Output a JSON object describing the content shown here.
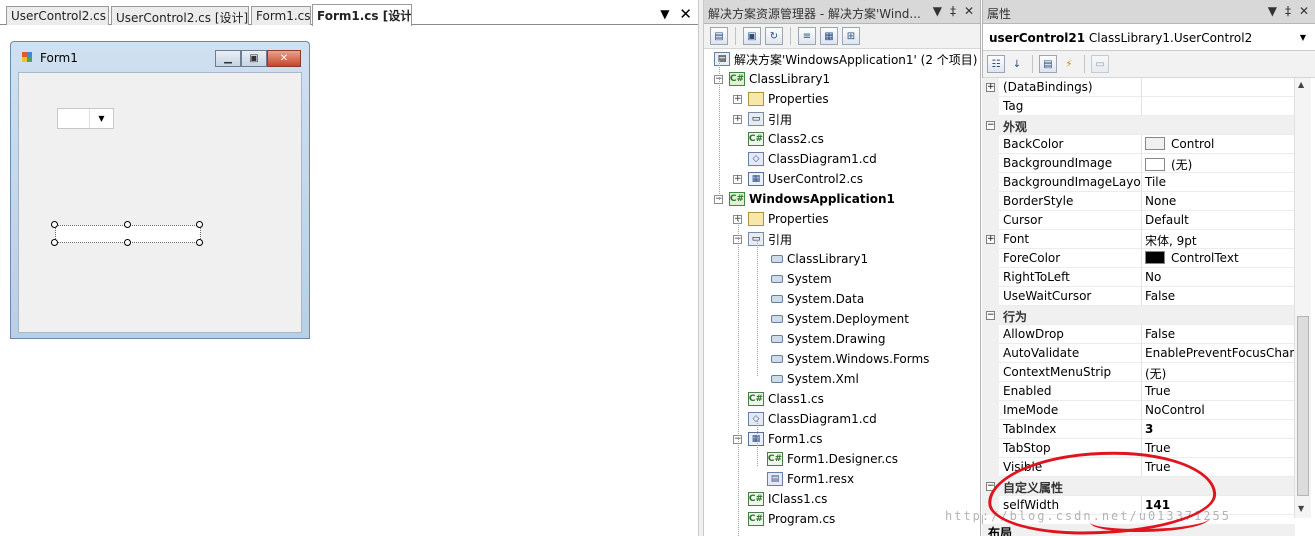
{
  "designer": {
    "tabs": [
      {
        "label": "UserControl2.cs"
      },
      {
        "label": "UserControl2.cs [设计]"
      },
      {
        "label": "Form1.cs"
      },
      {
        "label": "Form1.cs [设计]",
        "active": true
      }
    ],
    "tab_controls": {
      "dropdown": "▼",
      "close": "✕"
    },
    "form": {
      "title": "Form1",
      "min": "▁",
      "max": "▣",
      "close": "✕",
      "combo_arrow": "▼"
    }
  },
  "solution_explorer": {
    "title": "解决方案资源管理器 - 解决方案'Wind...",
    "title_controls": {
      "dropdown": "▼",
      "pin": "‡",
      "close": "✕"
    },
    "toolbar_icons": [
      "properties-icon",
      "show-all-files-icon",
      "refresh-icon",
      "view-code-icon",
      "view-designer-icon",
      "class-diagram-icon"
    ],
    "items": [
      {
        "label": "解决方案'WindowsApplication1' (2 个项目)",
        "icon": "solution",
        "level": 0,
        "expander": ""
      },
      {
        "label": "ClassLibrary1",
        "icon": "project",
        "level": 1,
        "expander": "−"
      },
      {
        "label": "Properties",
        "icon": "folder",
        "level": 2,
        "expander": "+"
      },
      {
        "label": "引用",
        "icon": "references",
        "level": 2,
        "expander": "+"
      },
      {
        "label": "Class2.cs",
        "icon": "cs",
        "level": 2,
        "expander": ""
      },
      {
        "label": "ClassDiagram1.cd",
        "icon": "cd",
        "level": 2,
        "expander": ""
      },
      {
        "label": "UserControl2.cs",
        "icon": "form",
        "level": 2,
        "expander": "+"
      },
      {
        "label": "WindowsApplication1",
        "icon": "project",
        "level": 1,
        "expander": "−",
        "bold": true
      },
      {
        "label": "Properties",
        "icon": "folder",
        "level": 2,
        "expander": "+"
      },
      {
        "label": "引用",
        "icon": "references",
        "level": 2,
        "expander": "−"
      },
      {
        "label": "ClassLibrary1",
        "icon": "assembly",
        "level": 3,
        "expander": ""
      },
      {
        "label": "System",
        "icon": "assembly",
        "level": 3,
        "expander": ""
      },
      {
        "label": "System.Data",
        "icon": "assembly",
        "level": 3,
        "expander": ""
      },
      {
        "label": "System.Deployment",
        "icon": "assembly",
        "level": 3,
        "expander": ""
      },
      {
        "label": "System.Drawing",
        "icon": "assembly",
        "level": 3,
        "expander": ""
      },
      {
        "label": "System.Windows.Forms",
        "icon": "assembly",
        "level": 3,
        "expander": ""
      },
      {
        "label": "System.Xml",
        "icon": "assembly",
        "level": 3,
        "expander": ""
      },
      {
        "label": "Class1.cs",
        "icon": "cs",
        "level": 2,
        "expander": ""
      },
      {
        "label": "ClassDiagram1.cd",
        "icon": "cd",
        "level": 2,
        "expander": ""
      },
      {
        "label": "Form1.cs",
        "icon": "form",
        "level": 2,
        "expander": "−"
      },
      {
        "label": "Form1.Designer.cs",
        "icon": "cs",
        "level": 3,
        "expander": ""
      },
      {
        "label": "Form1.resx",
        "icon": "resx",
        "level": 3,
        "expander": ""
      },
      {
        "label": "IClass1.cs",
        "icon": "cs",
        "level": 2,
        "expander": ""
      },
      {
        "label": "Program.cs",
        "icon": "cs",
        "level": 2,
        "expander": ""
      }
    ]
  },
  "properties": {
    "title": "属性",
    "title_controls": {
      "dropdown": "▼",
      "pin": "‡",
      "close": "✕"
    },
    "object_name": "userControl21",
    "object_type": "ClassLibrary1.UserControl2",
    "object_arrow": "▼",
    "toolbar_icons": [
      "categorized-icon",
      "alphabetical-icon",
      "properties-icon",
      "events-icon",
      "property-pages-icon"
    ],
    "rows": [
      {
        "type": "prop",
        "name": "(DataBindings)",
        "value": "",
        "expander": "+"
      },
      {
        "type": "prop",
        "name": "Tag",
        "value": ""
      },
      {
        "type": "cat",
        "name": "外观",
        "expander": "−"
      },
      {
        "type": "prop",
        "name": "BackColor",
        "value": "Control",
        "swatch": "#f0f0f0"
      },
      {
        "type": "prop",
        "name": "BackgroundImage",
        "value": "(无)",
        "swatch": "#ffffff"
      },
      {
        "type": "prop",
        "name": "BackgroundImageLayo",
        "value": "Tile"
      },
      {
        "type": "prop",
        "name": "BorderStyle",
        "value": "None"
      },
      {
        "type": "prop",
        "name": "Cursor",
        "value": "Default"
      },
      {
        "type": "prop",
        "name": "Font",
        "value": "宋体, 9pt",
        "expander": "+"
      },
      {
        "type": "prop",
        "name": "ForeColor",
        "value": "ControlText",
        "swatch": "#000000"
      },
      {
        "type": "prop",
        "name": "RightToLeft",
        "value": "No"
      },
      {
        "type": "prop",
        "name": "UseWaitCursor",
        "value": "False"
      },
      {
        "type": "cat",
        "name": "行为",
        "expander": "−"
      },
      {
        "type": "prop",
        "name": "AllowDrop",
        "value": "False"
      },
      {
        "type": "prop",
        "name": "AutoValidate",
        "value": "EnablePreventFocusChang"
      },
      {
        "type": "prop",
        "name": "ContextMenuStrip",
        "value": "(无)"
      },
      {
        "type": "prop",
        "name": "Enabled",
        "value": "True"
      },
      {
        "type": "prop",
        "name": "ImeMode",
        "value": "NoControl"
      },
      {
        "type": "prop",
        "name": "TabIndex",
        "value": "3",
        "bold": true
      },
      {
        "type": "prop",
        "name": "TabStop",
        "value": "True"
      },
      {
        "type": "prop",
        "name": "Visible",
        "value": "True"
      },
      {
        "type": "cat",
        "name": "自定义属性",
        "expander": "−"
      },
      {
        "type": "prop",
        "name": "selfWidth",
        "value": "141",
        "bold": true
      }
    ],
    "bottom_category": "布局",
    "scroll_up": "▲",
    "scroll_down": "▼"
  },
  "watermark": "http://blog.csdn.net/u013371255"
}
